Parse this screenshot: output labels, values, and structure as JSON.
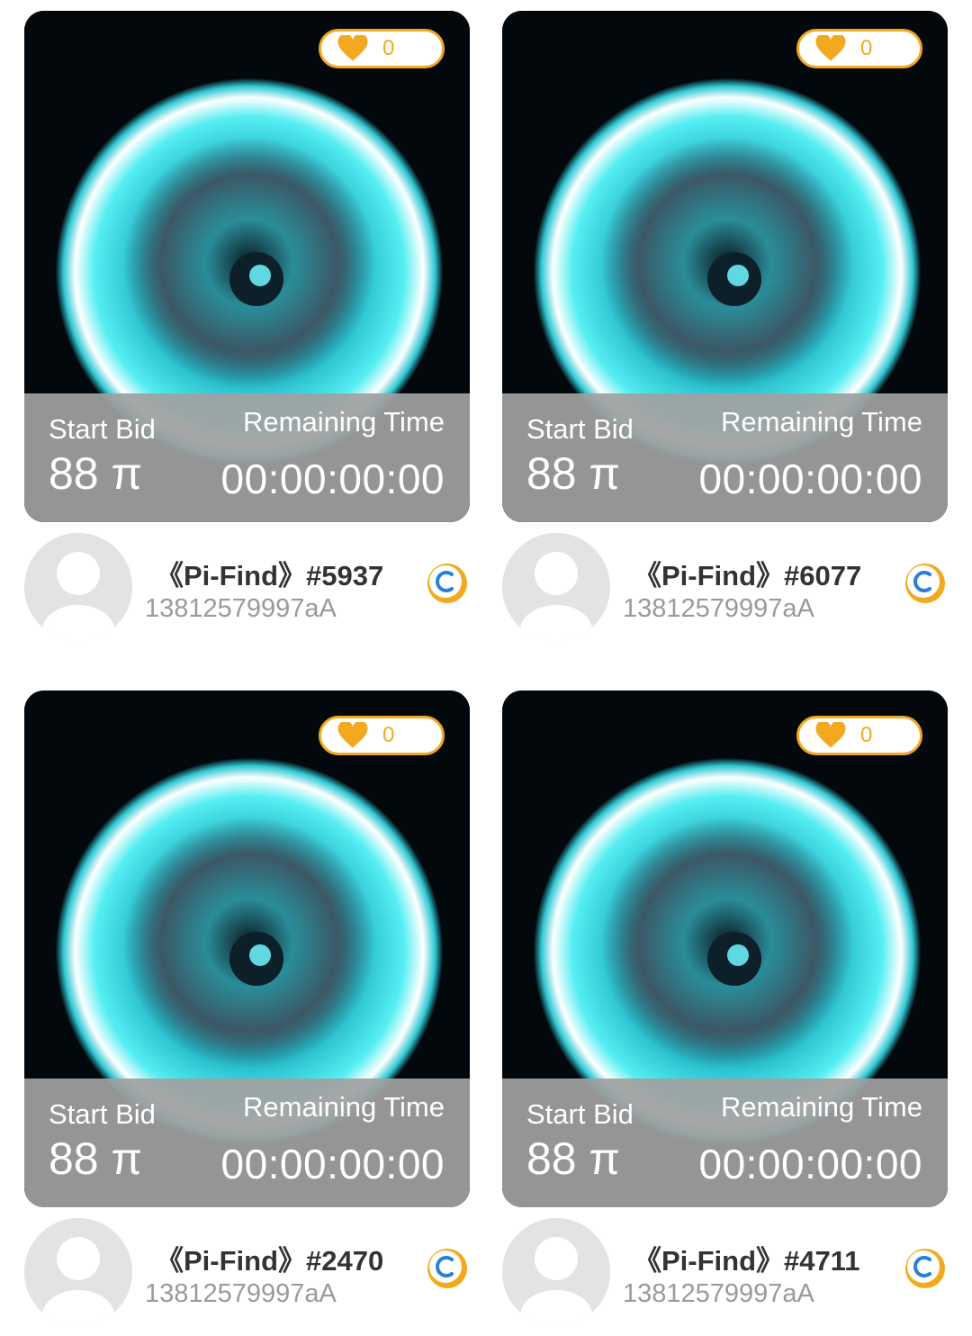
{
  "colors": {
    "accent_orange": "#f2a91f",
    "overlay_gray": "#a0a0a0",
    "title_text": "#333333",
    "owner_text": "#9a9a9a",
    "glow_cyan": "#3fe6ee"
  },
  "cards": [
    {
      "likes": "0",
      "start_bid_label": "Start Bid",
      "start_bid": "88 π",
      "remaining_label": "Remaining Time",
      "remaining_time": "00:00:00:00",
      "title": "《Pi-Find》#5937",
      "owner": "13812579997aA",
      "badge_icon": "copyright-coin-icon"
    },
    {
      "likes": "0",
      "start_bid_label": "Start Bid",
      "start_bid": "88 π",
      "remaining_label": "Remaining Time",
      "remaining_time": "00:00:00:00",
      "title": "《Pi-Find》#6077",
      "owner": "13812579997aA",
      "badge_icon": "copyright-coin-icon"
    },
    {
      "likes": "0",
      "start_bid_label": "Start Bid",
      "start_bid": "88 π",
      "remaining_label": "Remaining Time",
      "remaining_time": "00:00:00:00",
      "title": "《Pi-Find》#2470",
      "owner": "13812579997aA",
      "badge_icon": "copyright-coin-icon"
    },
    {
      "likes": "0",
      "start_bid_label": "Start Bid",
      "start_bid": "88 π",
      "remaining_label": "Remaining Time",
      "remaining_time": "00:00:00:00",
      "title": "《Pi-Find》#4711",
      "owner": "13812579997aA",
      "badge_icon": "copyright-coin-icon"
    }
  ]
}
